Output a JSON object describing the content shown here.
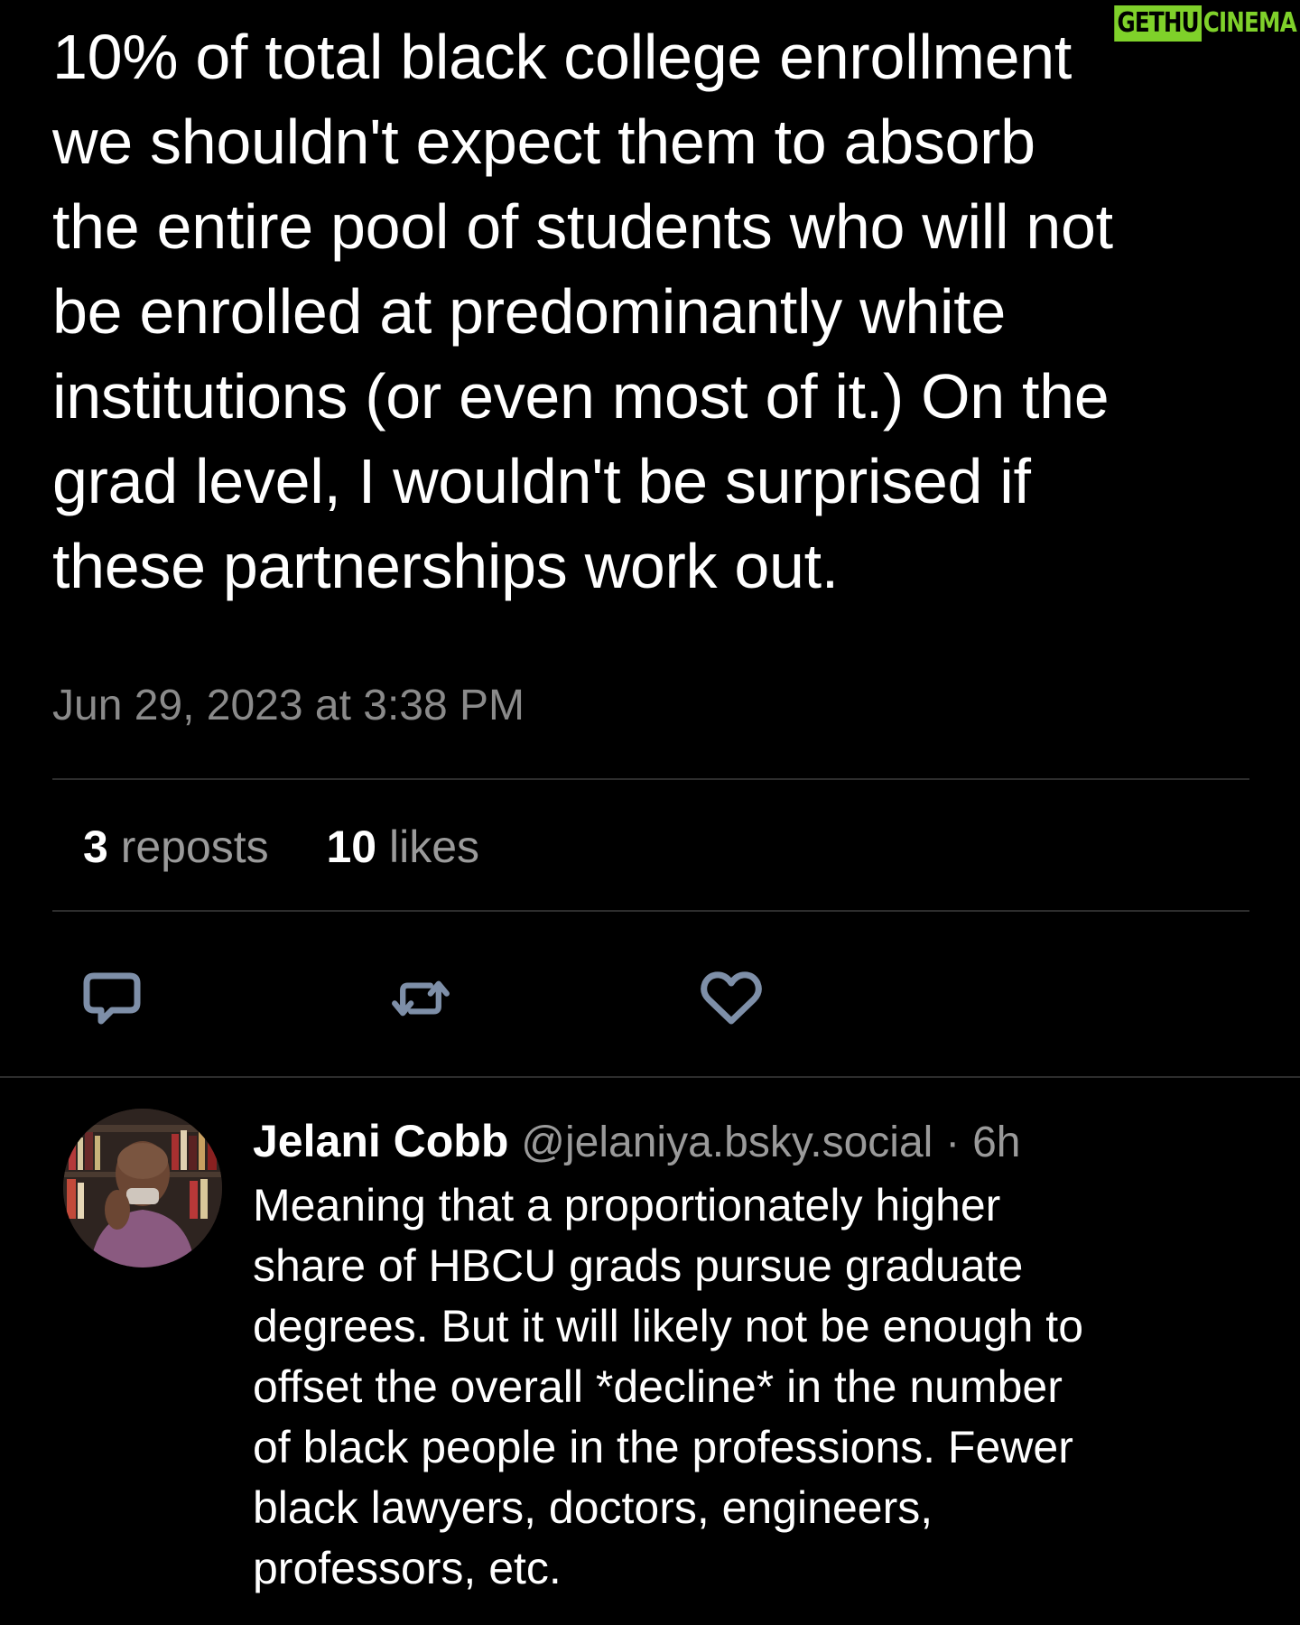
{
  "watermark": {
    "part_a": "GETHU",
    "part_b": "CINEMA"
  },
  "post": {
    "partial_top_line": "",
    "lines": [
      "10% of total black college enrollment",
      "we shouldn't expect them to absorb",
      "the entire pool of students who will not",
      "be enrolled at predominantly white",
      "institutions (or even most of it.) On the",
      "grad level, I wouldn't be surprised if",
      "these partnerships work out."
    ],
    "timestamp": "Jun 29, 2023 at 3:38 PM",
    "reposts_count": "3",
    "reposts_label": "reposts",
    "likes_count": "10",
    "likes_label": "likes"
  },
  "actions": {
    "reply_icon": "reply-bubble-icon",
    "repost_icon": "repost-icon",
    "like_icon": "heart-icon"
  },
  "reply": {
    "author": "Jelani Cobb",
    "handle": "@jelaniya.bsky.social",
    "separator": "·",
    "time": "6h",
    "lines": [
      "Meaning that a proportionately higher",
      "share of HBCU grads pursue graduate",
      "degrees. But it will likely not be enough to",
      "offset the overall *decline* in the number",
      "of black people in the professions. Fewer",
      "black lawyers, doctors, engineers,",
      "professors, etc."
    ]
  },
  "colors": {
    "background": "#000000",
    "text_primary": "#ffffff",
    "text_secondary": "#8a8a8a",
    "icon_color": "#7e8fa8",
    "watermark_green": "#7fd12a",
    "divider": "#2d2d2d"
  }
}
